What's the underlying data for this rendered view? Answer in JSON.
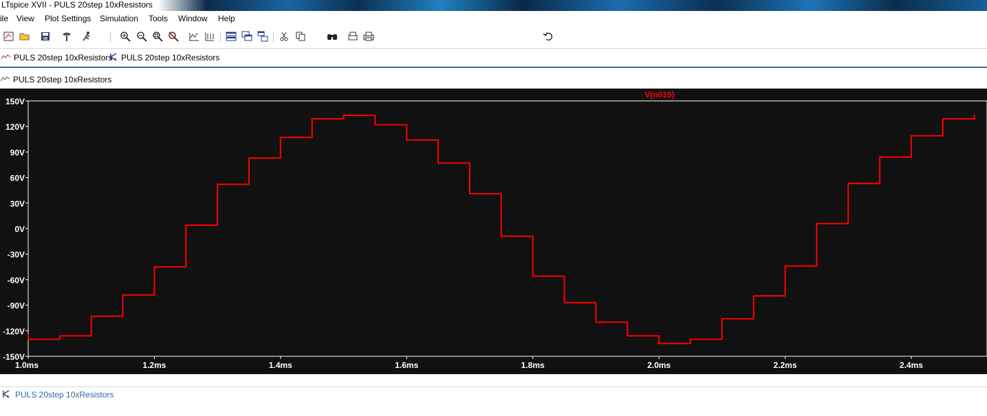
{
  "window": {
    "title": "LTspice XVII - PULS 20step 10xResistors"
  },
  "menu": [
    "ile",
    "View",
    "Plot Settings",
    "Simulation",
    "Tools",
    "Window",
    "Help"
  ],
  "toolbar": {
    "icons": [
      "schematic-icon",
      "open-icon",
      "save-icon",
      "control-panel-icon",
      "run-icon",
      "zoom-in-icon",
      "zoom-out-icon",
      "zoom-full-icon",
      "cancel-zoom-icon",
      "autorange-icon",
      "mark-icon",
      "tile-horizontal-icon",
      "cascade-icon",
      "tile-vertical-icon",
      "cut-icon",
      "copy-icon",
      "find-icon",
      "print-setup-icon",
      "print-icon",
      "undo-icon"
    ]
  },
  "tabs": [
    {
      "label": "PULS 20step 10xResistors",
      "icon": "waveform-icon"
    },
    {
      "label": "PULS 20step 10xResistors",
      "icon": "schematic-icon"
    }
  ],
  "pane": {
    "label": "PULS 20step 10xResistors",
    "icon": "waveform-icon"
  },
  "status": {
    "label": "PULS 20step 10xResistors",
    "icon": "schematic-icon"
  },
  "colors": {
    "plot_bg": "#111111",
    "trace": "#ff0000",
    "axis_text": "#ffffff"
  },
  "chart_data": {
    "type": "line",
    "title": "",
    "xlabel": "",
    "ylabel": "",
    "series": [
      {
        "name": "V(n015)",
        "color": "#ff0000",
        "x_ms": [
          0.998,
          1.0,
          1.05,
          1.05,
          1.1,
          1.1,
          1.15,
          1.15,
          1.2,
          1.2,
          1.25,
          1.25,
          1.3,
          1.3,
          1.35,
          1.35,
          1.4,
          1.4,
          1.45,
          1.45,
          1.5,
          1.5,
          1.55,
          1.55,
          1.6,
          1.6,
          1.65,
          1.65,
          1.7,
          1.7,
          1.75,
          1.75,
          1.8,
          1.8,
          1.85,
          1.85,
          1.9,
          1.9,
          1.95,
          1.95,
          2.0,
          2.0,
          2.05,
          2.05,
          2.1,
          2.1,
          2.15,
          2.15,
          2.2,
          2.2,
          2.25,
          2.25,
          2.3,
          2.3,
          2.35,
          2.35,
          2.4,
          2.4,
          2.45,
          2.45,
          2.5,
          2.5
        ],
        "y_V": [
          -124,
          -130,
          -130,
          -126,
          -126,
          -103,
          -103,
          -78,
          -78,
          -45,
          -45,
          4,
          4,
          52,
          52,
          83,
          83,
          107,
          107,
          129,
          129,
          133,
          133,
          122,
          122,
          104,
          104,
          77,
          77,
          41,
          41,
          -9,
          -9,
          -56,
          -56,
          -87,
          -87,
          -110,
          -110,
          -126,
          -126,
          -135,
          -135,
          -130,
          -130,
          -106,
          -106,
          -79,
          -79,
          -44,
          -44,
          6,
          6,
          53,
          53,
          84,
          84,
          109,
          109,
          129,
          129,
          134
        ]
      }
    ],
    "xlim_ms": [
      1.0,
      2.52
    ],
    "ylim_V": [
      -150,
      150
    ],
    "x_ticks": [
      "1.0ms",
      "1.2ms",
      "1.4ms",
      "1.6ms",
      "1.8ms",
      "2.0ms",
      "2.2ms",
      "2.4ms"
    ],
    "x_tick_values_ms": [
      1.0,
      1.2,
      1.4,
      1.6,
      1.8,
      2.0,
      2.2,
      2.4
    ],
    "y_ticks": [
      "150V",
      "120V",
      "90V",
      "60V",
      "30V",
      "0V",
      "-30V",
      "-60V",
      "-90V",
      "-120V",
      "-150V"
    ],
    "y_tick_values_V": [
      150,
      120,
      90,
      60,
      30,
      0,
      -30,
      -60,
      -90,
      -120,
      -150
    ],
    "legend": "top-center",
    "grid": false
  }
}
